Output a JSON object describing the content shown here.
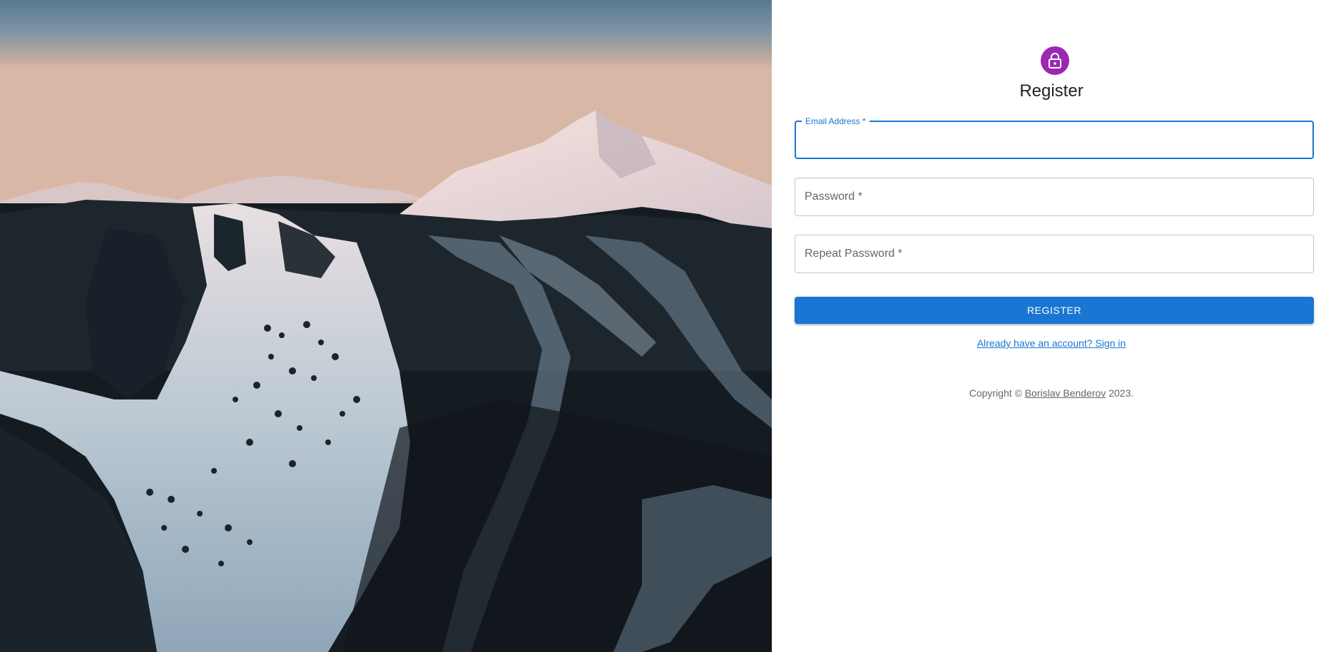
{
  "hero": {
    "image_icon": "mountain-photo"
  },
  "header": {
    "icon": "lock-icon",
    "icon_color": "#9c27b0",
    "title": "Register"
  },
  "form": {
    "email": {
      "label": "Email Address *",
      "value": ""
    },
    "password": {
      "placeholder": "Password *",
      "value": ""
    },
    "repeat_password": {
      "placeholder": "Repeat Password *",
      "value": ""
    },
    "submit_label": "REGISTER",
    "signin_link": "Already have an account? Sign in"
  },
  "footer": {
    "copyright_prefix": "Copyright © ",
    "author": "Borislav Benderov",
    "copyright_suffix": " 2023."
  },
  "colors": {
    "primary": "#1976d2",
    "avatar": "#9c27b0"
  }
}
